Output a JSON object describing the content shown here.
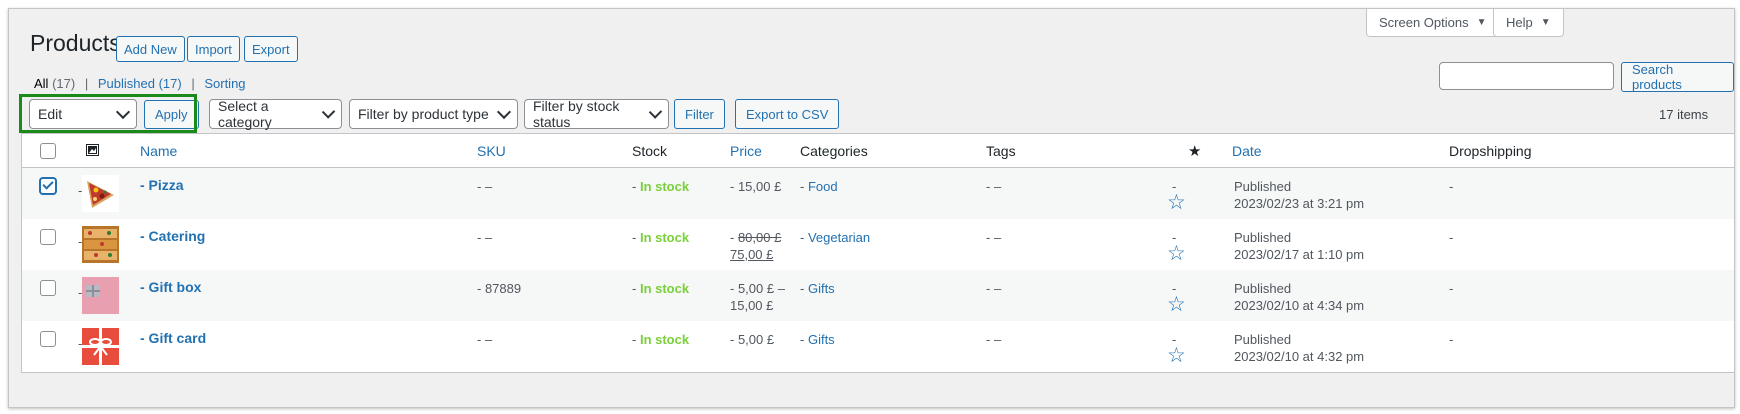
{
  "header": {
    "title": "Products",
    "add_new": "Add New",
    "import": "Import",
    "export": "Export",
    "screen_options": "Screen Options",
    "help": "Help"
  },
  "views": {
    "all": "All",
    "all_count": "(17)",
    "sep1": "|",
    "published": "Published",
    "published_count": "(17)",
    "sep2": "|",
    "sorting": "Sorting"
  },
  "search": {
    "placeholder": "",
    "button": "Search products"
  },
  "filters": {
    "bulk_action": "Edit",
    "apply": "Apply",
    "category": "Select a category",
    "product_type": "Filter by product type",
    "stock_status": "Filter by stock status",
    "filter_button": "Filter",
    "export_csv": "Export to CSV",
    "items_count": "17 items"
  },
  "table": {
    "columns": {
      "name": "Name",
      "sku": "SKU",
      "stock": "Stock",
      "price": "Price",
      "categories": "Categories",
      "tags": "Tags",
      "featured_icon": "★",
      "date": "Date",
      "dropshipping": "Dropshipping"
    },
    "rows": [
      {
        "checked": true,
        "name": "- Pizza",
        "sku": "- –",
        "stock": "In stock",
        "price_line1": "- 15,00 £",
        "price_line2": "",
        "category": "Food",
        "tags": "- –",
        "dash": "-",
        "date_status": "Published",
        "date": "2023/02/23 at 3:21 pm",
        "dropshipping": "-"
      },
      {
        "checked": false,
        "name": "- Catering",
        "sku": "- –",
        "stock": "In stock",
        "price_old": "80,00 £",
        "price_new": "75,00 £",
        "category": "Vegetarian",
        "tags": "- –",
        "dash": "-",
        "date_status": "Published",
        "date": "2023/02/17 at 1:10 pm",
        "dropshipping": "-"
      },
      {
        "checked": false,
        "name": "- Gift box",
        "sku": "- 87889",
        "stock": "In stock",
        "price_line1": "- 5,00 £ –",
        "price_line2": "15,00 £",
        "category": "Gifts",
        "tags": "- –",
        "dash": "-",
        "date_status": "Published",
        "date": "2023/02/10 at 4:34 pm",
        "dropshipping": "-"
      },
      {
        "checked": false,
        "name": "- Gift card",
        "sku": "- –",
        "stock": "In stock",
        "price_line1": "- 5,00 £",
        "price_line2": "",
        "category": "Gifts",
        "tags": "- –",
        "dash": "-",
        "date_status": "Published",
        "date": "2023/02/10 at 4:32 pm",
        "dropshipping": "-"
      }
    ]
  },
  "colors": {
    "accent": "#2271b1",
    "in_stock": "#7ad03a",
    "highlight": "#1a8a1a"
  }
}
